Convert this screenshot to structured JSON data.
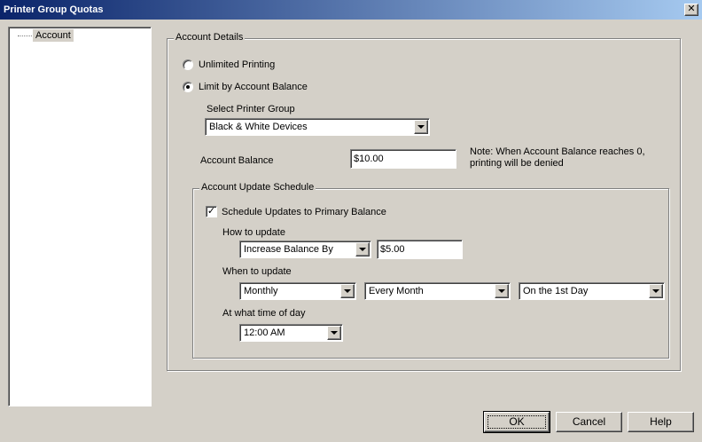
{
  "window": {
    "title": "Printer Group Quotas",
    "close_glyph": "✕"
  },
  "tree": {
    "items": [
      {
        "label": "Account"
      }
    ]
  },
  "account_details": {
    "legend": "Account Details",
    "unlimited_label": "Unlimited Printing",
    "limit_label": "Limit by Account Balance",
    "selected_mode": "limit",
    "printer_group_label": "Select Printer Group",
    "printer_group_value": "Black & White Devices",
    "balance_label": "Account Balance",
    "balance_value": "$10.00",
    "note": "Note: When Account Balance reaches 0, printing will be denied"
  },
  "schedule": {
    "legend": "Account Update Schedule",
    "checkbox_label": "Schedule Updates to Primary Balance",
    "checked": true,
    "how_label": "How to update",
    "how_value": "Increase Balance By",
    "amount_value": "$5.00",
    "when_label": "When to update",
    "frequency_value": "Monthly",
    "interval_value": "Every Month",
    "day_value": "On the 1st Day",
    "time_label": "At what time of day",
    "time_value": "12:00 AM"
  },
  "buttons": {
    "ok": "OK",
    "cancel": "Cancel",
    "help": "Help"
  },
  "icons": {
    "close": "close-icon",
    "dropdown": "chevron-down-icon",
    "check": "checkmark-icon"
  },
  "colors": {
    "face": "#d4d0c8",
    "title_start": "#0a246a",
    "title_end": "#a6caf0"
  }
}
